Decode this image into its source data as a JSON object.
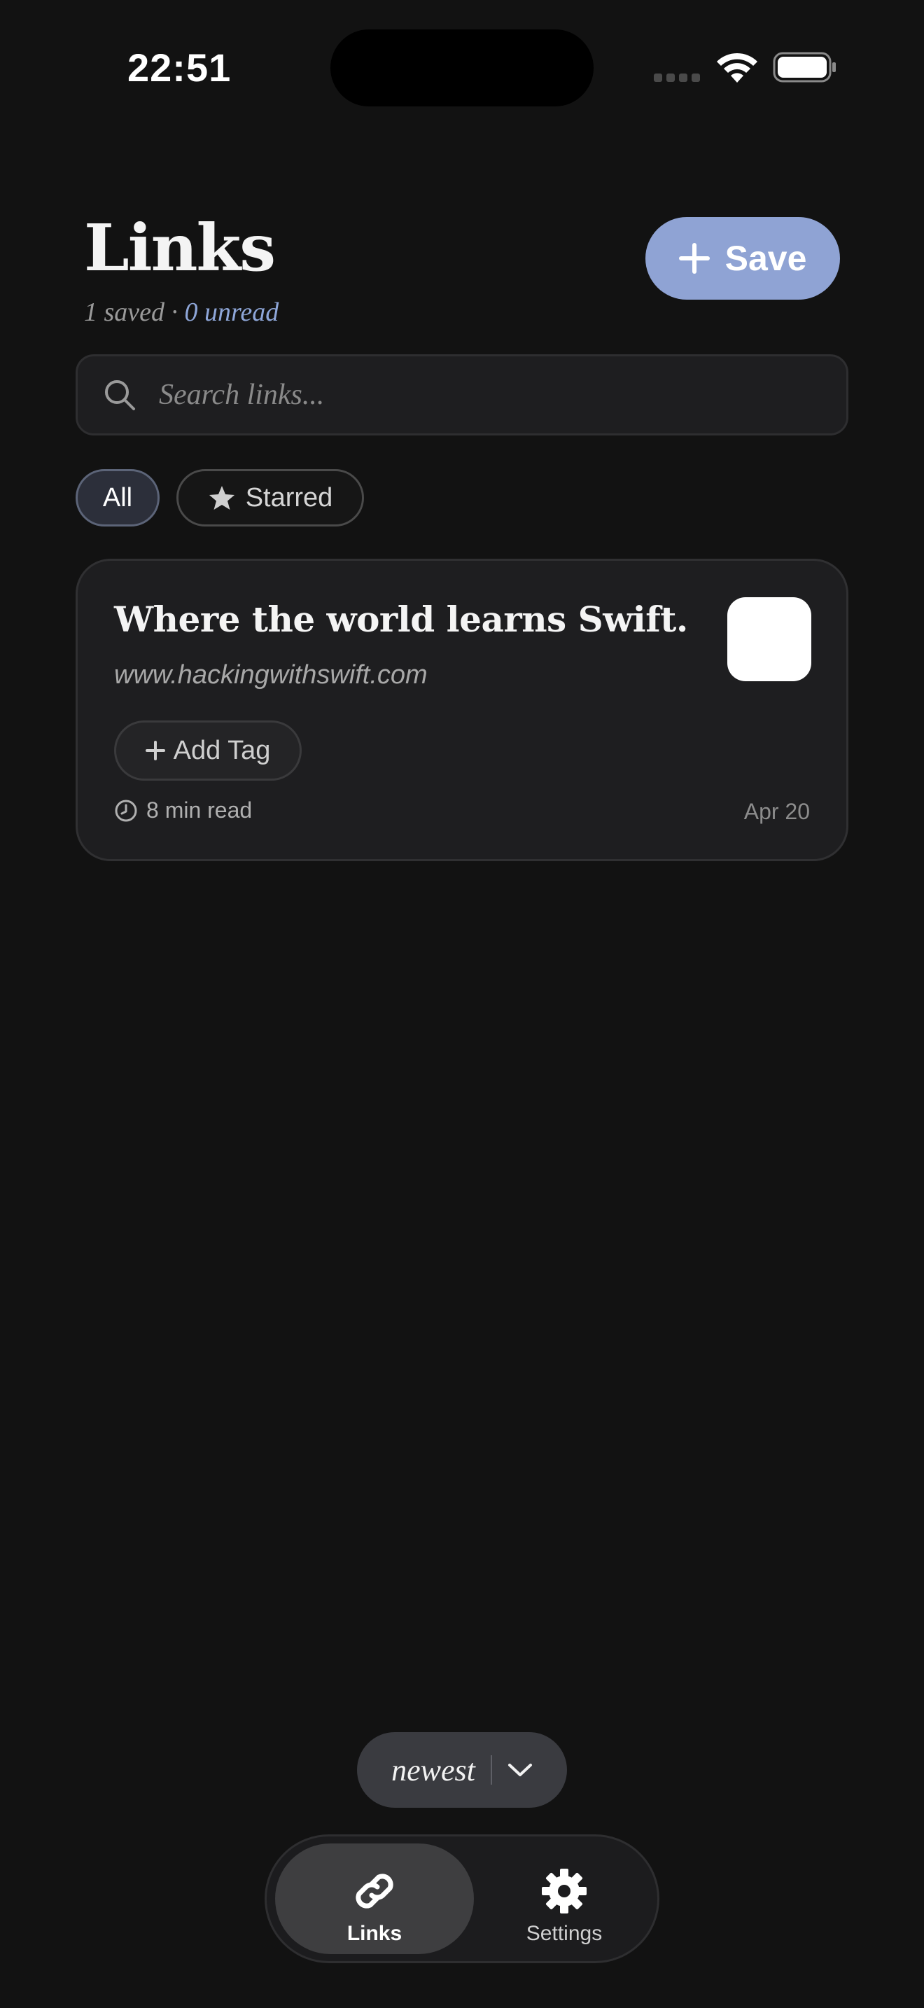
{
  "status_bar": {
    "time": "22:51"
  },
  "header": {
    "title": "Links",
    "saved_count": "1 saved · ",
    "unread_count": "0 unread",
    "save_label": "Save"
  },
  "search": {
    "placeholder": "Search links...",
    "value": ""
  },
  "filters": {
    "all_label": "All",
    "starred_label": "Starred",
    "selected": "All"
  },
  "links": [
    {
      "title": "Where the world learns Swift.",
      "url": "www.hackingwithswift.com",
      "add_tag_label": "Add Tag",
      "read_time": "8 min read",
      "date": "Apr 20"
    }
  ],
  "sort": {
    "label": "newest"
  },
  "tab_bar": {
    "tabs": [
      {
        "label": "Links",
        "icon": "link-icon",
        "selected": true
      },
      {
        "label": "Settings",
        "icon": "gear-icon",
        "selected": false
      }
    ]
  },
  "colors": {
    "background": "#121212",
    "accent": "#8fa3d4",
    "unread": "#8ea6d8",
    "card": "#1e1e20"
  }
}
